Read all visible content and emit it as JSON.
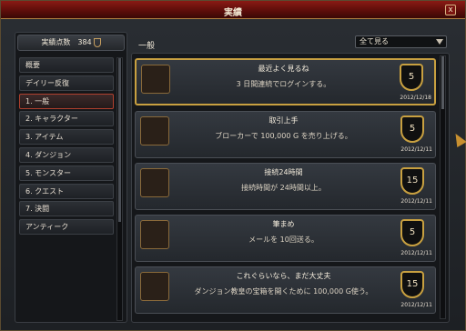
{
  "window": {
    "title": "実績",
    "close_label": "x"
  },
  "points": {
    "label": "実績点数",
    "value": "384"
  },
  "categories": [
    {
      "label": "概要"
    },
    {
      "label": "デイリー反復"
    },
    {
      "label": "1. 一般"
    },
    {
      "label": "2. キャラクター"
    },
    {
      "label": "3. アイテム"
    },
    {
      "label": "4. ダンジョン"
    },
    {
      "label": "5. モンスター"
    },
    {
      "label": "6. クエスト"
    },
    {
      "label": "7. 決闘"
    },
    {
      "label": "アンティーク"
    }
  ],
  "main": {
    "title": "一般",
    "filter": "全て見る"
  },
  "achievements": [
    {
      "name": "最近よく見るね",
      "desc": "3 日間連続でログインする。",
      "points": "5",
      "date": "2012/12/18"
    },
    {
      "name": "取引上手",
      "desc": "ブローカーで 100,000 G を売り上げる。",
      "points": "5",
      "date": "2012/12/11"
    },
    {
      "name": "接続24時間",
      "desc": "接続時間が 24時間以上。",
      "points": "15",
      "date": "2012/12/11"
    },
    {
      "name": "筆まめ",
      "desc": "メールを 10回送る。",
      "points": "5",
      "date": "2012/12/11"
    },
    {
      "name": "これぐらいなら、まだ大丈夫",
      "desc": "ダンジョン教皇の宝箱を開くために 100,000 G使う。",
      "points": "15",
      "date": "2012/12/11"
    }
  ],
  "colors": {
    "title_bar": "#7a1410",
    "highlight": "#c8a040",
    "active_category": "#b0402e"
  },
  "icons": [
    "close-icon",
    "medal-icon",
    "dropdown-arrow-icon",
    "clock-icon",
    "gold-coins-icon",
    "letter-icon",
    "shield-icon"
  ]
}
